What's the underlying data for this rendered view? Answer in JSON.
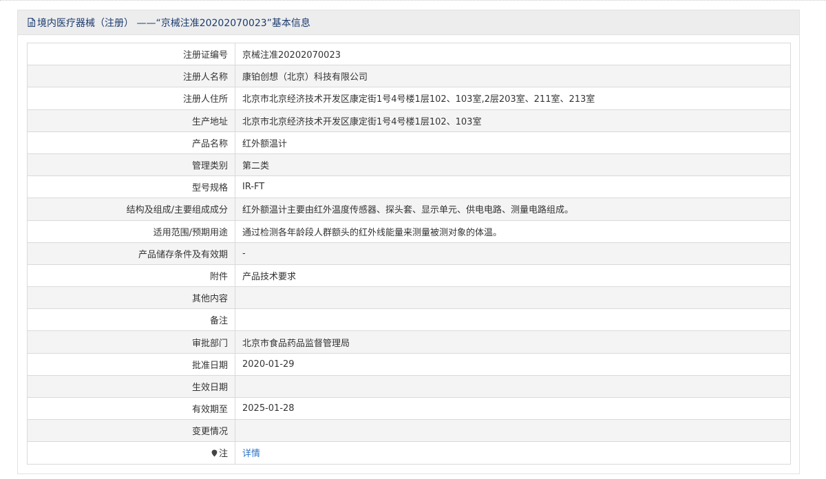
{
  "header": {
    "title": "境内医疗器械（注册） ——“京械注准20202070023”基本信息",
    "icon": "document-icon"
  },
  "rows": [
    {
      "label": "注册证编号",
      "value": "京械注准20202070023"
    },
    {
      "label": "注册人名称",
      "value": "康铂创想（北京）科技有限公司"
    },
    {
      "label": "注册人住所",
      "value": "北京市北京经济技术开发区康定街1号4号楼1层102、103室,2层203室、211室、213室"
    },
    {
      "label": "生产地址",
      "value": "北京市北京经济技术开发区康定街1号4号楼1层102、103室"
    },
    {
      "label": "产品名称",
      "value": "红外额温计"
    },
    {
      "label": "管理类别",
      "value": "第二类"
    },
    {
      "label": "型号规格",
      "value": "IR-FT"
    },
    {
      "label": "结构及组成/主要组成成分",
      "value": "红外额温计主要由红外温度传感器、探头套、显示单元、供电电路、测量电路组成。"
    },
    {
      "label": "适用范围/预期用途",
      "value": "通过检测各年龄段人群额头的红外线能量来测量被测对象的体温。"
    },
    {
      "label": "产品储存条件及有效期",
      "value": "-"
    },
    {
      "label": "附件",
      "value": "产品技术要求"
    },
    {
      "label": "其他内容",
      "value": ""
    },
    {
      "label": "备注",
      "value": ""
    },
    {
      "label": "审批部门",
      "value": "北京市食品药品监督管理局"
    },
    {
      "label": "批准日期",
      "value": "2020-01-29"
    },
    {
      "label": "生效日期",
      "value": ""
    },
    {
      "label": "有效期至",
      "value": "2025-01-28"
    },
    {
      "label": "变更情况",
      "value": ""
    }
  ],
  "note_row": {
    "label": "注",
    "icon": "map-pin-icon",
    "link_text": "详情"
  },
  "colors": {
    "header_bg": "#ededed",
    "header_text": "#1a3a6e",
    "stripe": "#f4f4f4",
    "link": "#2a73c8"
  }
}
